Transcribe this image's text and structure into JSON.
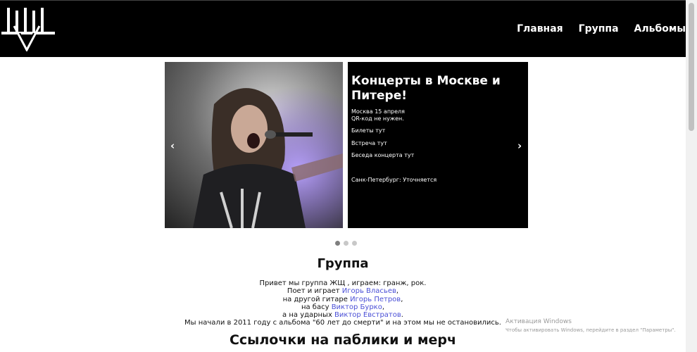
{
  "nav": {
    "links": [
      "Главная",
      "Группа",
      "Альбомы"
    ]
  },
  "carousel": {
    "slide_title": "Концерты в Москве и Питере!",
    "lines": [
      "Москва 15 апреля",
      "QR-код не нужен.",
      "Билеты тут",
      "Встреча тут",
      "Беседа концерта тут",
      "Санк-Петербург: Уточняется"
    ],
    "prev": "‹",
    "next": "›"
  },
  "about": {
    "title": "Группа",
    "line1": "Привет мы группа ЖЩ , играем: гранж, рок.",
    "line2_prefix": "Поет и играет ",
    "line2_link": "Игорь Власьев",
    "line2_suffix": ",",
    "line3_prefix": "на другой гитаре ",
    "line3_link": "Игорь Петров",
    "line3_suffix": ",",
    "line4_prefix": "на басу ",
    "line4_link": "Виктор Бурко",
    "line4_suffix": ",",
    "line5_prefix": "а на ударных ",
    "line5_link": "Виктор Евстратов",
    "line5_suffix": ".",
    "line6": "Мы начали в 2011 году с альбома \"60 лет до смерти\" и на этом мы не остановились."
  },
  "links_section": {
    "title": "Ссылочки на паблики и мерч"
  },
  "windows": {
    "title": "Активация Windows",
    "subtitle": "Чтобы активировать Windows, перейдите в раздел \"Параметры\"."
  }
}
